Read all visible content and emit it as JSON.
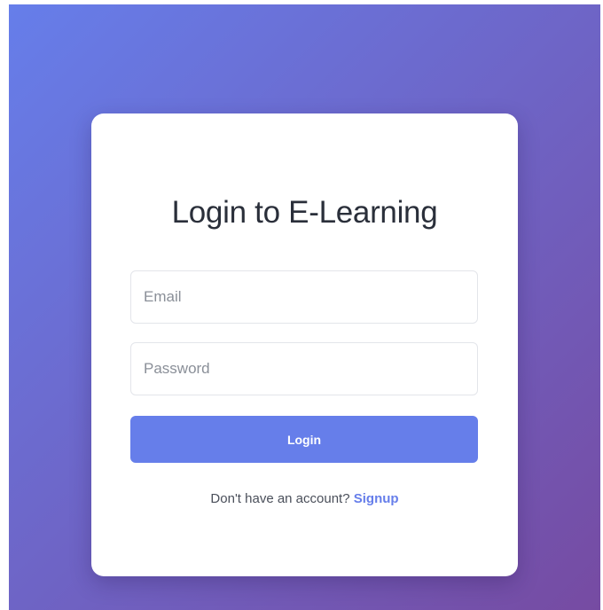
{
  "theme": {
    "background_gradient": [
      "#667eea",
      "#764ba2"
    ],
    "card_background": "#ffffff",
    "accent": "#667eea",
    "title_color": "#2a2f3a"
  },
  "login": {
    "title": "Login to E-Learning",
    "email": {
      "placeholder": "Email",
      "value": ""
    },
    "password": {
      "placeholder": "Password",
      "value": ""
    },
    "submit_label": "Login",
    "signup_prompt": "Don't have an account?",
    "signup_link": "Signup"
  }
}
